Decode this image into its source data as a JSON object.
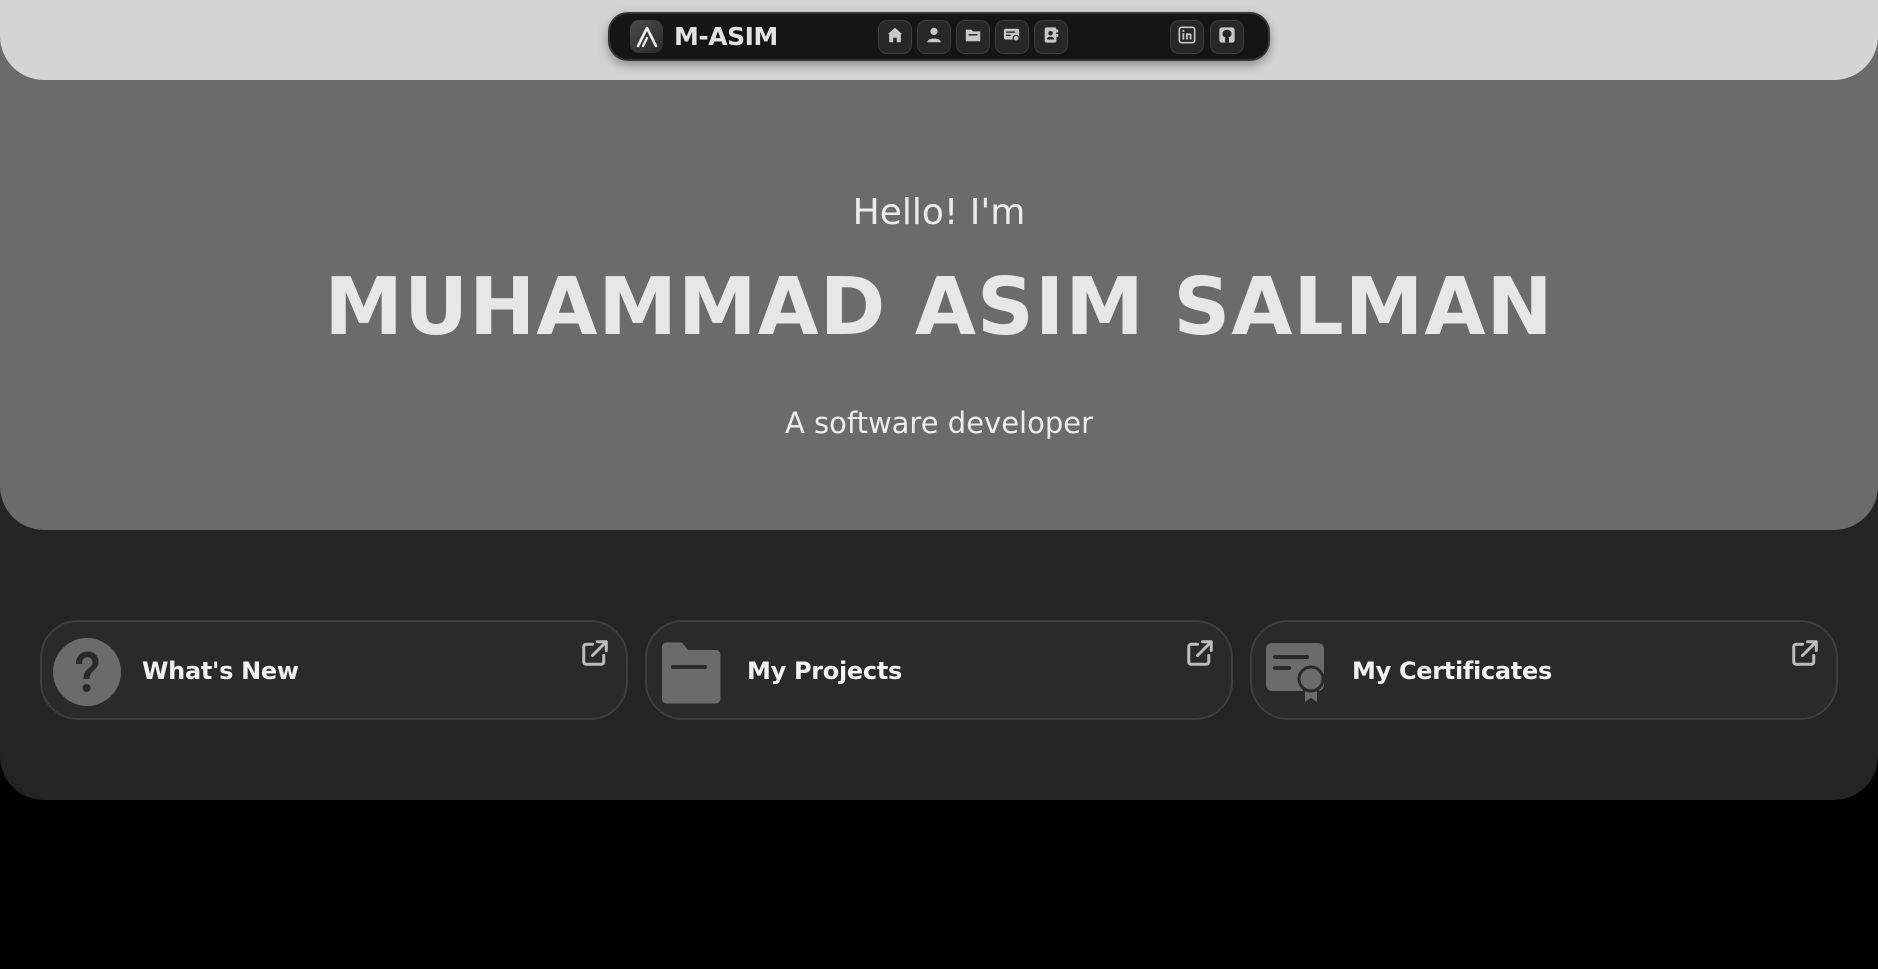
{
  "navbar": {
    "brand": "M-ASIM",
    "nav_icons": [
      "home-icon",
      "user-icon",
      "folder-icon",
      "certificate-icon",
      "contact-book-icon"
    ],
    "social_icons": [
      "linkedin-icon",
      "github-icon"
    ]
  },
  "hero": {
    "greeting": "Hello! I'm",
    "name": "MUHAMMAD ASIM SALMAN",
    "role": "A software developer"
  },
  "cards": [
    {
      "label": "What's New",
      "icon": "question-icon"
    },
    {
      "label": "My Projects",
      "icon": "folder-icon"
    },
    {
      "label": "My Certificates",
      "icon": "certificate-icon"
    }
  ],
  "colors": {
    "top_band": "#d4d4d4",
    "navbar": "#151515",
    "hero": "#6b6b6b",
    "lower_section": "#242424",
    "card": "#2a2a2a",
    "page": "#000000",
    "text_light": "#ececec"
  }
}
